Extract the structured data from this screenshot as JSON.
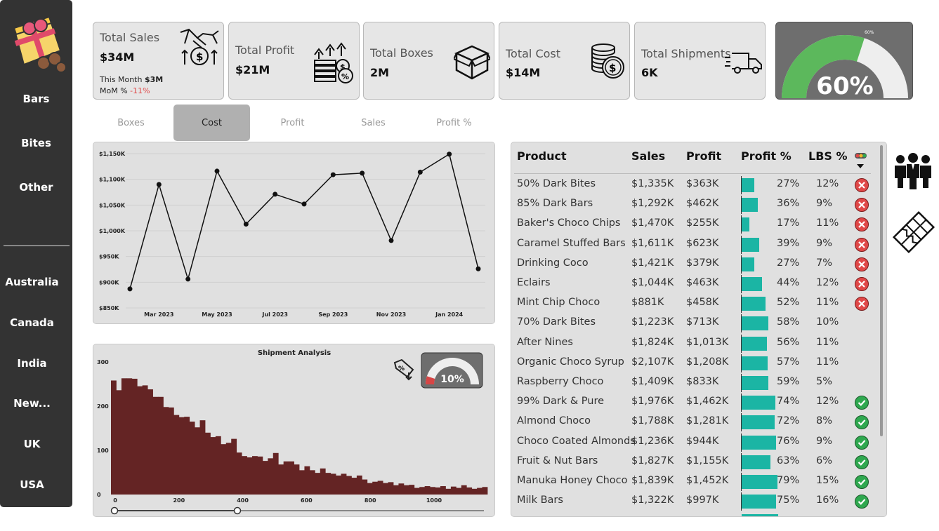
{
  "sidebar": {
    "items": [
      "Bars",
      "Bites",
      "Other"
    ],
    "countries": [
      "Australia",
      "Canada",
      "India",
      "New...",
      "UK",
      "USA"
    ]
  },
  "kpis": {
    "sales": {
      "label": "Total Sales",
      "value": "$34M",
      "month_label": "This Month",
      "month_value": "$3M",
      "mom_label": "MoM %",
      "mom_value": "-11%"
    },
    "profit": {
      "label": "Total Profit",
      "value": "$21M"
    },
    "boxes": {
      "label": "Total Boxes",
      "value": "2M"
    },
    "cost": {
      "label": "Total Cost",
      "value": "$14M"
    },
    "shipments": {
      "label": "Total Shipments",
      "value": "6K"
    }
  },
  "gauge": {
    "value": "60%",
    "mark": "60%",
    "fraction": 0.6
  },
  "tabs": [
    "Boxes",
    "Cost",
    "Profit",
    "Sales",
    "Profit %"
  ],
  "line_chart": {
    "type": "line",
    "x": [
      "Feb 2023",
      "Mar 2023",
      "Apr 2023",
      "May 2023",
      "Jun 2023",
      "Jul 2023",
      "Aug 2023",
      "Sep 2023",
      "Oct 2023",
      "Nov 2023",
      "Dec 2023",
      "Jan 2024",
      "Feb 2024"
    ],
    "values": [
      887,
      1090,
      906,
      1116,
      1013,
      1071,
      1052,
      1109,
      1112,
      981,
      1114,
      1149,
      926
    ],
    "x_ticks": [
      "Mar 2023",
      "May 2023",
      "Jul 2023",
      "Sep 2023",
      "Nov 2023",
      "Jan 2024"
    ],
    "y_ticks": [
      "$850K",
      "$900K",
      "$950K",
      "$1,000K",
      "$1,050K",
      "$1,100K",
      "$1,150K"
    ],
    "ylim": [
      850,
      1150
    ]
  },
  "histogram": {
    "type": "bar",
    "title": "Shipment Analysis",
    "values": [
      258,
      236,
      263,
      263,
      262,
      245,
      247,
      238,
      221,
      221,
      198,
      197,
      180,
      175,
      176,
      165,
      152,
      168,
      140,
      130,
      132,
      114,
      117,
      126,
      95,
      87,
      84,
      87,
      86,
      76,
      82,
      94,
      68,
      75,
      75,
      68,
      55,
      64,
      55,
      49,
      59,
      49,
      47,
      43,
      47,
      42,
      38,
      43,
      34,
      26,
      29,
      31,
      26,
      28,
      21,
      25,
      21,
      22,
      15,
      17,
      19,
      17,
      16,
      19,
      13,
      18,
      15,
      21,
      16,
      13,
      15,
      17
    ],
    "x_ticks": [
      "0",
      "200",
      "400",
      "600",
      "800",
      "1000"
    ],
    "y_ticks": [
      "0",
      "100",
      "200",
      "300"
    ],
    "ylim": [
      0,
      300
    ],
    "mini_gauge": {
      "value": "10%",
      "fraction": 0.1
    }
  },
  "table": {
    "headers": [
      "Product",
      "Sales",
      "Profit",
      "Profit %",
      "LBS %"
    ],
    "rows": [
      {
        "product": "50% Dark Bites",
        "sales": "$1,335K",
        "profit": "$363K",
        "pct": "27%",
        "p": 27,
        "lbs": "12%",
        "status": "bad"
      },
      {
        "product": "85% Dark Bars",
        "sales": "$1,292K",
        "profit": "$462K",
        "pct": "36%",
        "p": 36,
        "lbs": "9%",
        "status": "bad"
      },
      {
        "product": "Baker's Choco Chips",
        "sales": "$1,470K",
        "profit": "$255K",
        "pct": "17%",
        "p": 17,
        "lbs": "11%",
        "status": "bad"
      },
      {
        "product": "Caramel Stuffed Bars",
        "sales": "$1,611K",
        "profit": "$623K",
        "pct": "39%",
        "p": 39,
        "lbs": "9%",
        "status": "bad"
      },
      {
        "product": "Drinking Coco",
        "sales": "$1,421K",
        "profit": "$379K",
        "pct": "27%",
        "p": 27,
        "lbs": "7%",
        "status": "bad"
      },
      {
        "product": "Eclairs",
        "sales": "$1,044K",
        "profit": "$463K",
        "pct": "44%",
        "p": 44,
        "lbs": "12%",
        "status": "bad"
      },
      {
        "product": "Mint Chip Choco",
        "sales": "$881K",
        "profit": "$458K",
        "pct": "52%",
        "p": 52,
        "lbs": "11%",
        "status": "bad"
      },
      {
        "product": "70% Dark Bites",
        "sales": "$1,223K",
        "profit": "$713K",
        "pct": "58%",
        "p": 58,
        "lbs": "10%",
        "status": ""
      },
      {
        "product": "After Nines",
        "sales": "$1,824K",
        "profit": "$1,013K",
        "pct": "56%",
        "p": 56,
        "lbs": "11%",
        "status": ""
      },
      {
        "product": "Organic Choco Syrup",
        "sales": "$2,107K",
        "profit": "$1,208K",
        "pct": "57%",
        "p": 57,
        "lbs": "11%",
        "status": ""
      },
      {
        "product": "Raspberry Choco",
        "sales": "$1,409K",
        "profit": "$833K",
        "pct": "59%",
        "p": 59,
        "lbs": "5%",
        "status": ""
      },
      {
        "product": "99% Dark & Pure",
        "sales": "$1,976K",
        "profit": "$1,462K",
        "pct": "74%",
        "p": 74,
        "lbs": "12%",
        "status": "good"
      },
      {
        "product": "Almond Choco",
        "sales": "$1,788K",
        "profit": "$1,281K",
        "pct": "72%",
        "p": 72,
        "lbs": "8%",
        "status": "good"
      },
      {
        "product": "Choco Coated Almonds",
        "sales": "$1,236K",
        "profit": "$944K",
        "pct": "76%",
        "p": 76,
        "lbs": "9%",
        "status": "good"
      },
      {
        "product": "Fruit & Nut Bars",
        "sales": "$1,827K",
        "profit": "$1,155K",
        "pct": "63%",
        "p": 63,
        "lbs": "6%",
        "status": "good"
      },
      {
        "product": "Manuka Honey Choco",
        "sales": "$1,839K",
        "profit": "$1,452K",
        "pct": "79%",
        "p": 79,
        "lbs": "15%",
        "status": "good"
      },
      {
        "product": "Milk Bars",
        "sales": "$1,322K",
        "profit": "$997K",
        "pct": "75%",
        "p": 75,
        "lbs": "16%",
        "status": "good"
      }
    ]
  },
  "colors": {
    "accent": "#1bb5a4",
    "gauge_green": "#5cb85c",
    "hist_bar": "#642424",
    "bad": "#e04848",
    "good": "#2fa84f"
  }
}
